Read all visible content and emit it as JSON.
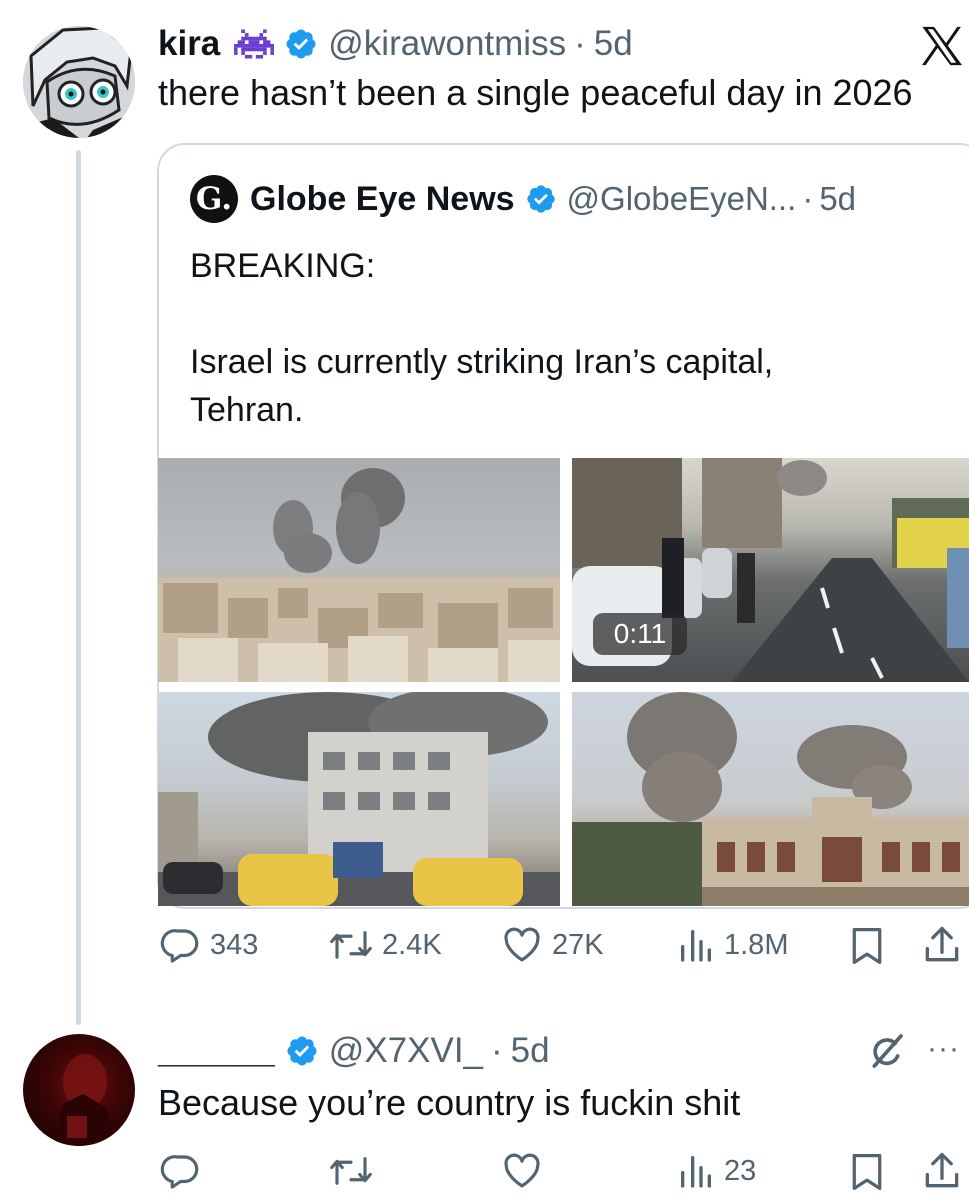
{
  "tweet": {
    "name": "kira",
    "name_emoji": "alien-monster-icon",
    "handle": "@kirawontmiss",
    "sep": "·",
    "time": "5d",
    "text": "there hasn’t been a single peaceful day in 2026",
    "platform_logo": "x-logo-icon"
  },
  "quote": {
    "logo_letter": "G.",
    "name": "Globe Eye News",
    "handle": "@GlobeEyeN...",
    "sep": "·",
    "time": "5d",
    "lines": [
      "BREAKING:",
      "Israel is currently striking Iran’s capital,",
      "Tehran."
    ],
    "video_duration": "0:11"
  },
  "tweet_actions": {
    "replies": "343",
    "reposts": "2.4K",
    "likes": "27K",
    "views": "1.8M"
  },
  "reply": {
    "name": "______",
    "handle": "@X7XVI_",
    "sep": "·",
    "time": "5d",
    "text": "Because you’re country is fuckin shit",
    "more": "···"
  },
  "reply_actions": {
    "views": "23"
  },
  "colors": {
    "verified": "#1d9bf0",
    "secondary_text": "#536471",
    "primary_text": "#0f1419",
    "border": "#cfd9de"
  }
}
